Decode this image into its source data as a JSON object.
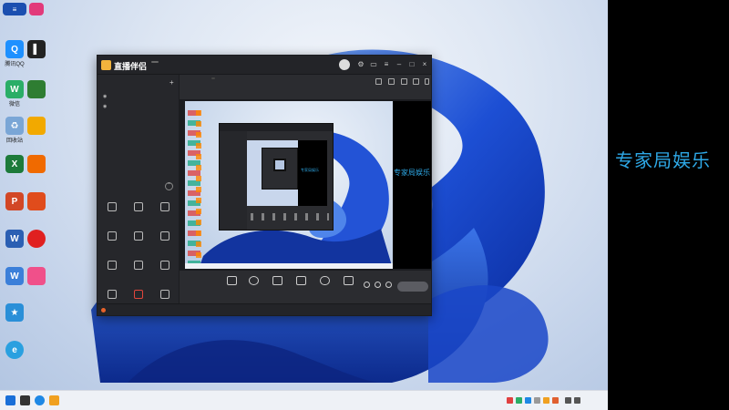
{
  "desktop": {
    "icons": [
      {
        "label": "腾讯QQ",
        "color": "#1e90ff",
        "glyph": "Q"
      },
      {
        "label": "",
        "color": "#222222",
        "glyph": ""
      },
      {
        "label": "微信",
        "color": "#2aae67",
        "glyph": "W"
      },
      {
        "label": "",
        "color": "#2e7d32",
        "glyph": ""
      },
      {
        "label": "回收站",
        "color": "#7aa6d6",
        "glyph": ""
      },
      {
        "label": "",
        "color": "#f2a900",
        "glyph": ""
      },
      {
        "label": "",
        "color": "#1d7a3a",
        "glyph": "X"
      },
      {
        "label": "",
        "color": "#f06a00",
        "glyph": ""
      },
      {
        "label": "",
        "color": "#d24726",
        "glyph": "P"
      },
      {
        "label": "",
        "color": "#e04c1c",
        "glyph": ""
      },
      {
        "label": "",
        "color": "#2b5fb3",
        "glyph": "W"
      },
      {
        "label": "",
        "color": "#e02020",
        "glyph": ""
      },
      {
        "label": "",
        "color": "#3b7fd9",
        "glyph": ""
      },
      {
        "label": "",
        "color": "#f0508a",
        "glyph": ""
      },
      {
        "label": "",
        "color": "#2a8fd8",
        "glyph": "★"
      },
      {
        "label": "",
        "color": "#2aa0e0",
        "glyph": "e"
      }
    ]
  },
  "right_panel": {
    "text": "专家局娱乐"
  },
  "app": {
    "name": "直播伴侣",
    "version": "",
    "sidebar": {
      "tabs": [
        "",
        ""
      ],
      "scenes": [
        "",
        ""
      ],
      "toolbox_title": "",
      "tools": [
        {
          "label": ""
        },
        {
          "label": ""
        },
        {
          "label": ""
        },
        {
          "label": ""
        },
        {
          "label": ""
        },
        {
          "label": ""
        },
        {
          "label": ""
        },
        {
          "label": ""
        },
        {
          "label": ""
        },
        {
          "label": ""
        },
        {
          "label": ""
        },
        {
          "label": ""
        }
      ]
    },
    "scene_bar": {
      "name": "",
      "badge": ""
    },
    "stream_bar": {
      "tag": "",
      "stats": [
        "",
        "",
        ""
      ]
    },
    "preview_text": "专家局娱乐",
    "controls": [
      {
        "label": ""
      },
      {
        "label": ""
      },
      {
        "label": ""
      },
      {
        "label": ""
      },
      {
        "label": ""
      },
      {
        "label": ""
      }
    ],
    "go_live": "",
    "status": {
      "notice": "",
      "sys": [
        "",
        "",
        "",
        ""
      ]
    }
  },
  "taskbar": {
    "clock": {
      "time": "",
      "date": ""
    },
    "app_colors": [
      "#1a6fd8",
      "#333333",
      "#1e88e5",
      "#f0a020"
    ],
    "tray_colors": [
      "#e04040",
      "#2aae67",
      "#1e88e5",
      "#999999",
      "#f0a020",
      "#e06030",
      "#555555",
      "#555555",
      "#555555"
    ]
  }
}
